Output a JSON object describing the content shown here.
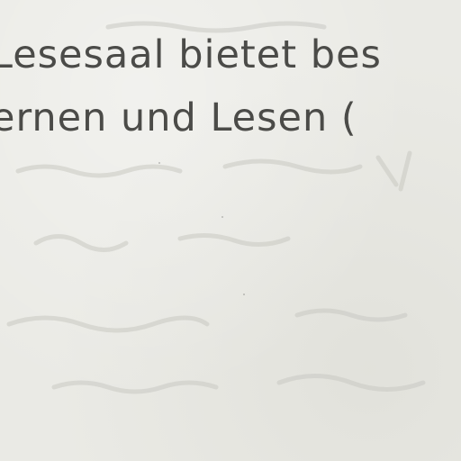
{
  "document": {
    "lines": [
      "Lesesaal bietet bes",
      "ernen und Lesen ("
    ]
  }
}
